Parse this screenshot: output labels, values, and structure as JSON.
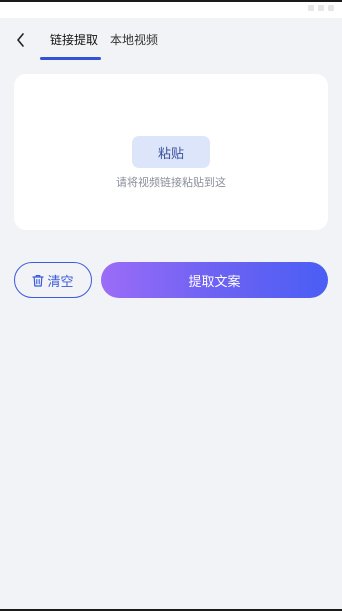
{
  "header": {
    "tabs": [
      {
        "label": "链接提取",
        "active": true
      },
      {
        "label": "本地视频",
        "active": false
      }
    ]
  },
  "paste_card": {
    "paste_label": "粘贴",
    "hint": "请将视频链接粘贴到这"
  },
  "actions": {
    "clear_label": "清空",
    "extract_label": "提取文案"
  },
  "icons": {
    "back": "chevron-left-icon",
    "clear": "trash-icon"
  },
  "colors": {
    "accent": "#3b5bdb",
    "paste_bg": "#dde5fb",
    "gradient_start": "#9b6cf7",
    "gradient_end": "#4a5ef4",
    "page_bg": "#f1f3f6"
  }
}
